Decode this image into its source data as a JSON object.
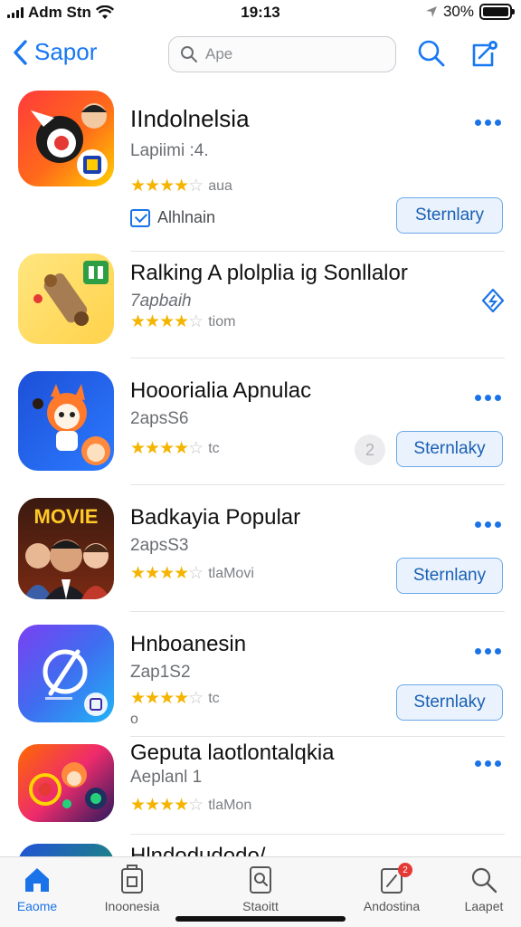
{
  "status_bar": {
    "carrier": "Adm Stn",
    "time": "19:13",
    "battery": "30%"
  },
  "nav": {
    "back_label": "Sapor",
    "search_placeholder": "Ape"
  },
  "apps": [
    {
      "title": "IIndolnelsia",
      "subtitle": "Lapiimi :4.",
      "stars": 4,
      "rating_label": "aua",
      "check_label": "Alhlnain",
      "button": "Sternlary",
      "has_more": true
    },
    {
      "title": "Ralking A plolplia ig Sonllalor",
      "subtitle": "7apbaih",
      "stars": 3.5,
      "rating_label": "tiom",
      "has_more": false
    },
    {
      "title": "Hooorialia Apnulac",
      "subtitle": "2apsS6",
      "stars": 4,
      "rating_label": "tc",
      "progress_label": "2",
      "button": "Sternlaky",
      "has_more": true
    },
    {
      "title": "Badkayia Popular",
      "subtitle": "2apsS3",
      "stars": 4,
      "rating_label": "tlaMovi",
      "icon_text": "MOVIE",
      "button": "Sternlany",
      "has_more": true
    },
    {
      "title": "Hnboanesin",
      "subtitle": "Zap1S2",
      "stars": 4,
      "rating_label": "tc",
      "extra": "o",
      "button": "Sternlaky",
      "has_more": true
    },
    {
      "title": "Geputa laotlontalqkia",
      "subtitle": "Aeplanl 1",
      "stars": 4,
      "rating_label": "tlaMon",
      "has_more": true
    },
    {
      "title": "Hlndodudodo/",
      "subtitle": "",
      "stars": 0,
      "rating_label": "",
      "has_more": false
    }
  ],
  "tabs": [
    {
      "label": "Eaome",
      "icon": "home-icon",
      "active": true
    },
    {
      "label": "Inoonesia",
      "icon": "apps-icon",
      "active": false
    },
    {
      "label": "Staoitt",
      "icon": "search-doc-icon",
      "active": false
    },
    {
      "label": "Andostina",
      "icon": "updates-icon",
      "badge": "2",
      "active": false
    },
    {
      "label": "Laapet",
      "icon": "search-icon",
      "active": false
    }
  ],
  "colors": {
    "accent": "#1a73e8",
    "star": "#f4b400",
    "button_bg": "#eaf3fd",
    "button_border": "#6aa8e8"
  }
}
